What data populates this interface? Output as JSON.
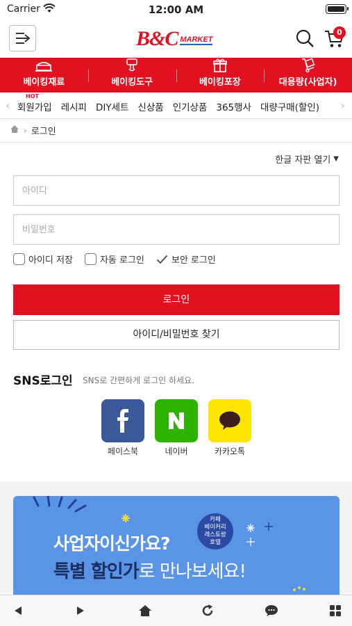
{
  "status_bar": {
    "carrier": "Carrier",
    "time": "12:00 AM"
  },
  "header": {
    "logo_main": "B&C",
    "logo_sub": "MARKET",
    "cart_count": "0",
    "icons": [
      "menu-icon",
      "search-icon",
      "cart-icon"
    ]
  },
  "categories": [
    {
      "label": "베이킹재료",
      "icon": "cake-icon"
    },
    {
      "label": "베이킹도구",
      "icon": "mixer-icon"
    },
    {
      "label": "베이킹포장",
      "icon": "gift-icon"
    },
    {
      "label": "대용량(사업자)",
      "icon": "hand-truck-icon"
    }
  ],
  "sub_nav": {
    "hot_tag": "HOT",
    "items": [
      "회원가입",
      "레시피",
      "DIY세트",
      "신상품",
      "인기상품",
      "365행사",
      "대량구매(할인)"
    ]
  },
  "breadcrumb": {
    "current": "로그인"
  },
  "login": {
    "keyboard_toggle": "한글 자판 열기",
    "id_placeholder": "아이디",
    "pw_placeholder": "비밀번호",
    "opt_save_id": "아이디 저장",
    "opt_auto_login": "자동 로그인",
    "opt_secure_login": "보안 로그인",
    "login_button": "로그인",
    "find_button": "아이디/비밀번호 찾기"
  },
  "sns": {
    "title": "SNS로그인",
    "desc": "SNS로 간편하게 로그인 하세요.",
    "items": [
      {
        "label": "페이스북",
        "color": "#3b5898"
      },
      {
        "label": "네이버",
        "color": "#2db400"
      },
      {
        "label": "카카오톡",
        "color": "#fee500"
      }
    ]
  },
  "banner": {
    "line1": "사업자이신가요?",
    "line2_bold": "특별 할인가",
    "line2_rest": "로 만나보세요!",
    "badge": [
      "카페",
      "베이커리",
      "레스토랑",
      "호텔"
    ]
  },
  "colors": {
    "brand_red": "#e2111f",
    "banner_blue": "#5a94e6"
  }
}
